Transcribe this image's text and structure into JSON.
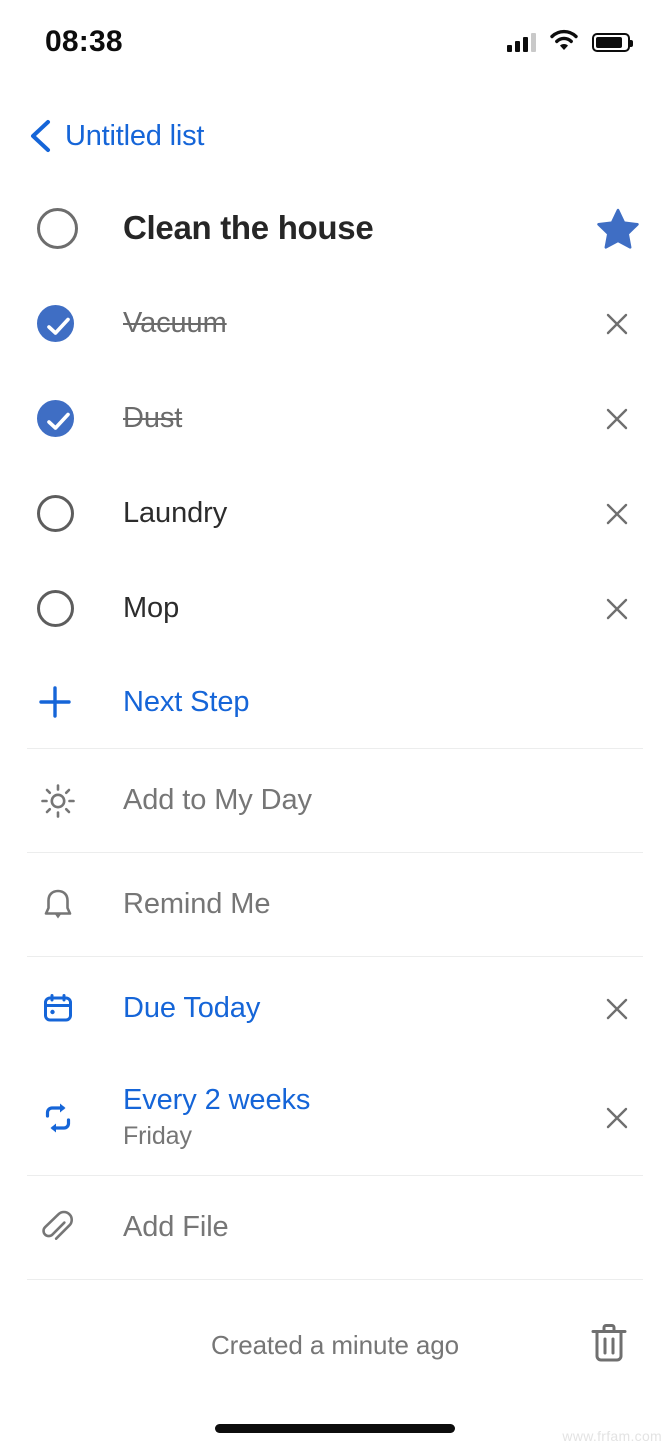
{
  "status_bar": {
    "time": "08:38",
    "signal_icon": "cellular-signal-icon",
    "wifi_icon": "wifi-icon",
    "battery_icon": "battery-icon"
  },
  "nav": {
    "back_icon": "chevron-left-icon",
    "list_name": "Untitled list"
  },
  "task": {
    "title": "Clean the house",
    "completed": false,
    "checkbox_icon": "circle-unchecked-icon",
    "star_icon": "star-filled-icon",
    "starred": true
  },
  "steps": [
    {
      "label": "Vacuum",
      "completed": true,
      "remove_icon": "close-icon"
    },
    {
      "label": "Dust",
      "completed": true,
      "remove_icon": "close-icon"
    },
    {
      "label": "Laundry",
      "completed": false,
      "remove_icon": "close-icon"
    },
    {
      "label": "Mop",
      "completed": false,
      "remove_icon": "close-icon"
    }
  ],
  "next_step": {
    "label": "Next Step",
    "icon": "plus-icon"
  },
  "meta": {
    "my_day": {
      "label": "Add to My Day",
      "icon": "sun-icon"
    },
    "reminder": {
      "label": "Remind Me",
      "icon": "bell-icon"
    },
    "due": {
      "label": "Due Today",
      "icon": "calendar-icon",
      "remove_icon": "close-icon"
    },
    "repeat": {
      "label": "Every 2 weeks",
      "sub": "Friday",
      "icon": "repeat-icon",
      "remove_icon": "close-icon"
    },
    "file": {
      "label": "Add File",
      "icon": "paperclip-icon"
    }
  },
  "footer": {
    "created_text": "Created a minute ago",
    "delete_icon": "trash-icon"
  },
  "watermark": "www.frfam.com",
  "colors": {
    "accent_blue": "#1565d8",
    "check_blue": "#3f6ec4",
    "star_blue": "#3f6ec4",
    "muted_gray": "#767676",
    "divider": "#eceded"
  }
}
